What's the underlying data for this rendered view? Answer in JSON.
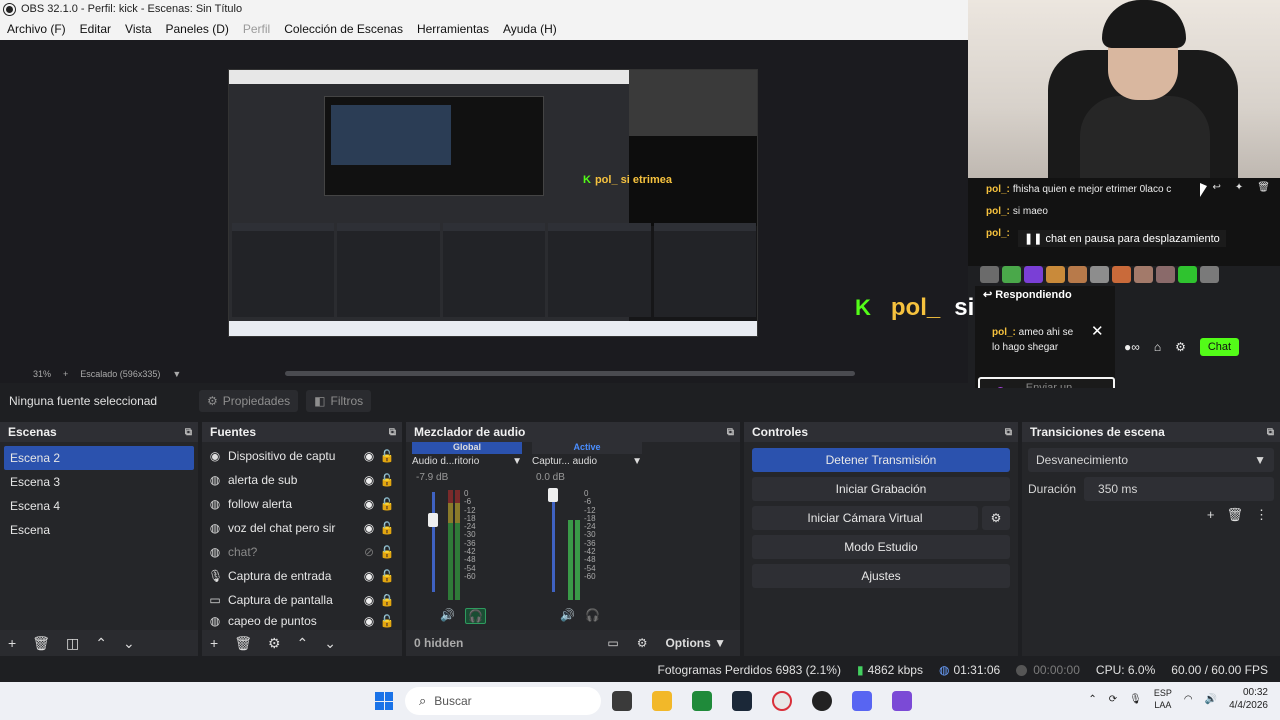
{
  "window": {
    "title": "OBS 32.1.0 - Perfil: kick - Escenas: Sin Título"
  },
  "menu": [
    {
      "label": "Archivo (F)",
      "enabled": true
    },
    {
      "label": "Editar",
      "enabled": true
    },
    {
      "label": "Vista",
      "enabled": true
    },
    {
      "label": "Paneles (D)",
      "enabled": true
    },
    {
      "label": "Perfil",
      "enabled": false
    },
    {
      "label": "Colección de Escenas",
      "enabled": true
    },
    {
      "label": "Herramientas",
      "enabled": true
    },
    {
      "label": "Ayuda (H)",
      "enabled": true
    }
  ],
  "preview": {
    "zoom": "31%",
    "scale_label": "Escalado (596x335)",
    "nested_overlay_user": "pol_",
    "nested_overlay_msg": "si etrimea"
  },
  "source_bar": {
    "no_selection": "Ninguna fuente seleccionad",
    "properties": "Propiedades",
    "filters": "Filtros"
  },
  "scenes": {
    "title": "Escenas",
    "items": [
      "Escena 2",
      "Escena 3",
      "Escena 4",
      "Escena"
    ],
    "selected_index": 0
  },
  "sources": {
    "title": "Fuentes",
    "items": [
      {
        "label": "Dispositivo de captu",
        "icon": "camera-icon",
        "visible": true,
        "locked": false
      },
      {
        "label": "alerta de sub",
        "icon": "globe-icon",
        "visible": true,
        "locked": false
      },
      {
        "label": "follow alerta",
        "icon": "globe-icon",
        "visible": true,
        "locked": false
      },
      {
        "label": "voz del chat pero sir",
        "icon": "globe-icon",
        "visible": true,
        "locked": false
      },
      {
        "label": "chat?",
        "icon": "globe-icon",
        "visible": false,
        "locked": false
      },
      {
        "label": "Captura de entrada",
        "icon": "mic-icon",
        "visible": true,
        "locked": false
      },
      {
        "label": "Captura de pantalla",
        "icon": "monitor-icon",
        "visible": true,
        "locked": true
      },
      {
        "label": "capeo de puntos",
        "icon": "globe-icon",
        "visible": true,
        "locked": false
      }
    ]
  },
  "mixer": {
    "title": "Mezclador de audio",
    "tab_global": "Global",
    "tab_active": "Active",
    "channels": [
      {
        "name": "Audio d...ritorio",
        "db": "-7.9 dB",
        "fader_level": 0.75
      },
      {
        "name": "Captur... audio",
        "db": "0.0 dB",
        "fader_level": 1.0
      }
    ],
    "scale": [
      "0",
      "-6",
      "-12",
      "-18",
      "-24",
      "-30",
      "-36",
      "-42",
      "-48",
      "-54",
      "-60"
    ],
    "hidden": "0 hidden",
    "options": "Options"
  },
  "controls": {
    "title": "Controles",
    "stop_stream": "Detener Transmisión",
    "start_recording": "Iniciar Grabación",
    "start_virtual_cam": "Iniciar Cámara Virtual",
    "studio_mode": "Modo Estudio",
    "settings": "Ajustes"
  },
  "transitions": {
    "title": "Transiciones de escena",
    "selected": "Desvanecimiento",
    "duration_label": "Duración",
    "duration_value": "350 ms"
  },
  "status": {
    "dropped_frames": "Fotogramas Perdidos 6983 (2.1%)",
    "bitrate": "4862 kbps",
    "stream_time": "01:31:06",
    "record_time": "00:00:00",
    "cpu": "CPU: 6.0%",
    "fps": "60.00 / 60.00 FPS"
  },
  "taskbar": {
    "search_placeholder": "Buscar",
    "lang": "ESP",
    "layout": "LAA",
    "time": "00:32",
    "date": "4/4/2026"
  },
  "chat": {
    "messages": [
      {
        "user": "pol_:",
        "text": "fhisha quien e mejor etrimer 0laco c"
      },
      {
        "user": "pol_:",
        "text": "si maeo"
      },
      {
        "user": "pol_:",
        "text": ""
      }
    ],
    "paused": "chat en pausa para desplazamiento",
    "replying": "Respondiendo",
    "reply_user": "pol_:",
    "reply_text": "ameo ahi se lo hago shegar",
    "input_placeholder": "Enviar un mensaje",
    "chat_button": "Chat"
  },
  "overlay": {
    "user": "pol_",
    "message": "si etrimea"
  },
  "colors": {
    "accent": "#2b52ae",
    "kick_green": "#53fc18",
    "username": "#f6c23e"
  }
}
